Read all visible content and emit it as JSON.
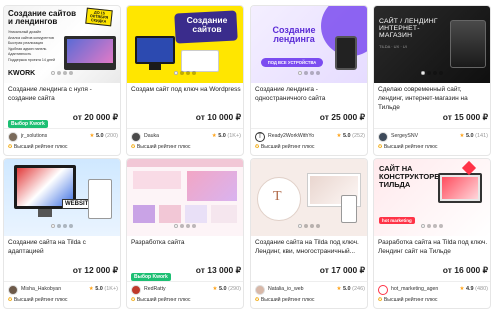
{
  "cards": [
    {
      "thumb_title": "Создание сайтов и лендингов",
      "thumb_features": [
        "Уникальный дизайн",
        "Анализ сайтов конкурентов",
        "Быстрая реализация",
        "Удобная админ панель",
        "Адаптивность",
        "Поддержка проекта 14 дней"
      ],
      "thumb_sticker": "ДО 15 ОКТЯБРЯ СКИДКА",
      "thumb_brand": "KWORK",
      "title": "Создание лендинга с нуля - создание сайта",
      "choice": "Выбор Kwork",
      "price": "от 20 000 ₽",
      "seller": "jr_solutions",
      "rating": "5.0",
      "reviews": "(200)",
      "badge": "Высший рейтинг плюс"
    },
    {
      "thumb_title": "Создание сайтов",
      "title": "Создам сайт под ключ на Wordpress",
      "choice": "",
      "price": "от 10 000 ₽",
      "seller": "Dauka",
      "rating": "5.0",
      "reviews": "(1K+)",
      "badge": "Высший рейтинг плюс"
    },
    {
      "thumb_title": "Создание лендинга",
      "thumb_subtitle": "ПОД ВСЕ УСТРОЙСТВА",
      "title": "Создание лендинга - одностраничного сайта",
      "choice": "",
      "price": "от 25 000 ₽",
      "seller": "Ready2WorkWithYo",
      "rating": "5.0",
      "reviews": "(252)",
      "badge": "Высший рейтинг плюс"
    },
    {
      "thumb_title": "САЙТ / ЛЕНДИНГ ИНТЕРНЕТ-МАГАЗИН",
      "thumb_subtitle": "TILDA · UX · UI",
      "title": "Сделаю современный сайт, лендинг, интернет-магазин на Тильде",
      "choice": "",
      "price": "от 15 000 ₽",
      "seller": "SergeySNV",
      "rating": "5.0",
      "reviews": "(141)",
      "badge": "Высший рейтинг плюс"
    },
    {
      "thumb_title": "WEBSITE",
      "title": "Создание сайта на Tilda с адаптацией",
      "choice": "",
      "price": "от 12 000 ₽",
      "seller": "Misha_Hakobyan",
      "rating": "5.0",
      "reviews": "(1K+)",
      "badge": "Высший рейтинг плюс"
    },
    {
      "thumb_title": "",
      "title": "Разработка сайта",
      "choice": "Выбор Kwork",
      "price": "от 13 000 ₽",
      "seller": "RedRatty",
      "rating": "5.0",
      "reviews": "(290)",
      "badge": "Высший рейтинг плюс"
    },
    {
      "thumb_title": "",
      "title": "Создание сайта на Tilda под ключ. Лендинг, кви, многостраничный...",
      "choice": "",
      "price": "от 17 000 ₽",
      "seller": "Natalia_io_web",
      "rating": "5.0",
      "reviews": "(246)",
      "badge": "Высший рейтинг плюс"
    },
    {
      "thumb_title": "САЙТ НА КОНСТРУКТОРЕ ТИЛЬДА",
      "thumb_brand": "hot marketing",
      "title": "Разработка сайта на Tilda под ключ. Лендинг сайт на Тильде",
      "choice": "",
      "price": "от 16 000 ₽",
      "seller": "hot_marketing_agen",
      "rating": "4.9",
      "reviews": "(480)",
      "badge": "Высший рейтинг плюс"
    }
  ]
}
